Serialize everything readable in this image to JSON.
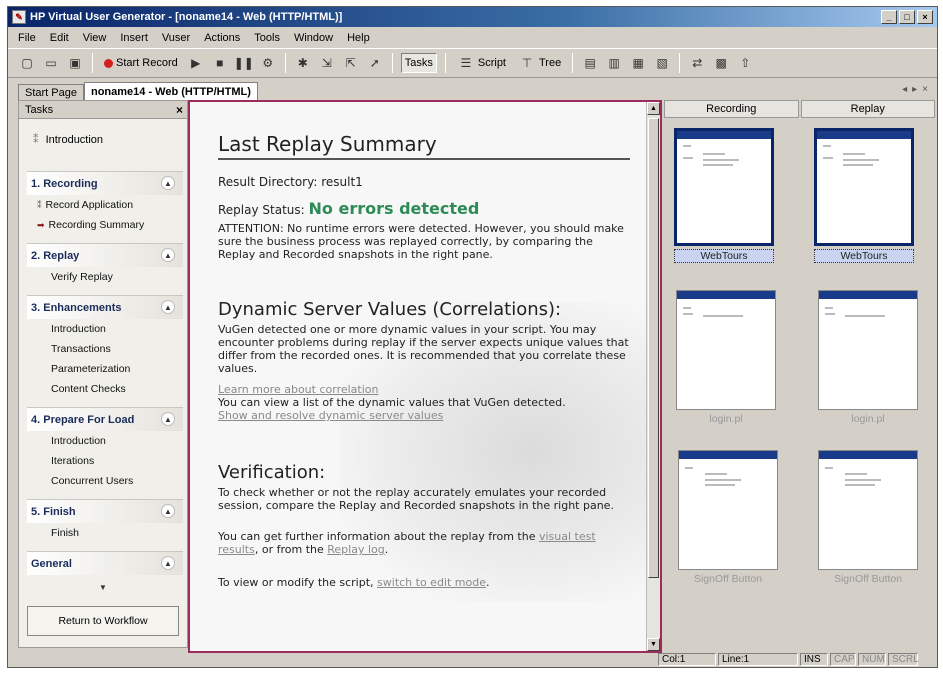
{
  "window": {
    "title": "HP Virtual User Generator - [noname14 - Web (HTTP/HTML)]",
    "controls": [
      "_",
      "□",
      "×"
    ]
  },
  "menu": [
    "File",
    "Edit",
    "View",
    "Insert",
    "Vuser",
    "Actions",
    "Tools",
    "Window",
    "Help"
  ],
  "toolbar": {
    "start_record": "Start Record",
    "tasks": "Tasks",
    "script": "Script",
    "tree": "Tree"
  },
  "doc_tabs": [
    "Start Page",
    "noname14 - Web (HTTP/HTML)"
  ],
  "tasks_pane": {
    "title": "Tasks",
    "intro": "Introduction",
    "sections": [
      {
        "title": "1. Recording",
        "items": [
          "Record Application",
          "Recording Summary"
        ]
      },
      {
        "title": "2. Replay",
        "items": [
          "Verify Replay"
        ]
      },
      {
        "title": "3. Enhancements",
        "items": [
          "Introduction",
          "Transactions",
          "Parameterization",
          "Content Checks"
        ]
      },
      {
        "title": "4. Prepare For Load",
        "items": [
          "Introduction",
          "Iterations",
          "Concurrent Users"
        ]
      },
      {
        "title": "5. Finish",
        "items": [
          "Finish"
        ]
      },
      {
        "title": "General",
        "items": []
      }
    ],
    "return_button": "Return to Workflow"
  },
  "summary": {
    "title": "Last Replay Summary",
    "result_dir_label": "Result Directory:",
    "result_dir": "result1",
    "status_label": "Replay Status:",
    "status_value": "No errors detected",
    "attention": "ATTENTION: No runtime errors were detected. However, you should make sure the business process was replayed correctly, by comparing the Replay and Recorded snapshots in the right pane.",
    "dynamic_title": "Dynamic Server Values (Correlations):",
    "dynamic_text": "VuGen detected one or more dynamic values in your script. You may encounter problems during replay if the server expects unique values that differ from the recorded ones. It is recommended that you correlate these values.",
    "learn_link": "Learn more about correlation",
    "list_text": "You can view a list of the dynamic values that VuGen detected.",
    "show_link": "Show and resolve dynamic server values",
    "verification_title": "Verification:",
    "verification_text": "To check whether or not the replay accurately emulates your recorded session, compare the Replay and Recorded snapshots in the right pane.",
    "further_pre": "You can get further information about the replay from the",
    "visual_link": "visual test results",
    "further_mid": ", or from the",
    "replay_log_link": "Replay log",
    "further_end": ".",
    "edit_pre": "To view or modify the script,",
    "edit_link": "switch to edit mode",
    "edit_end": "."
  },
  "snapshots": {
    "tabs": [
      "Recording",
      "Replay"
    ],
    "rows": [
      {
        "label_left": "WebTours",
        "label_right": "WebTours",
        "selected": true
      },
      {
        "label_left": "login.pl",
        "label_right": "login.pl",
        "selected": false
      },
      {
        "label_left": "SignOff Button",
        "label_right": "SignOff Button",
        "selected": false
      }
    ]
  },
  "statusbar": {
    "col": "Col:1",
    "line": "Line:1",
    "ins": "INS",
    "cap": "CAP",
    "num": "NUM",
    "scrl": "SCRL"
  }
}
